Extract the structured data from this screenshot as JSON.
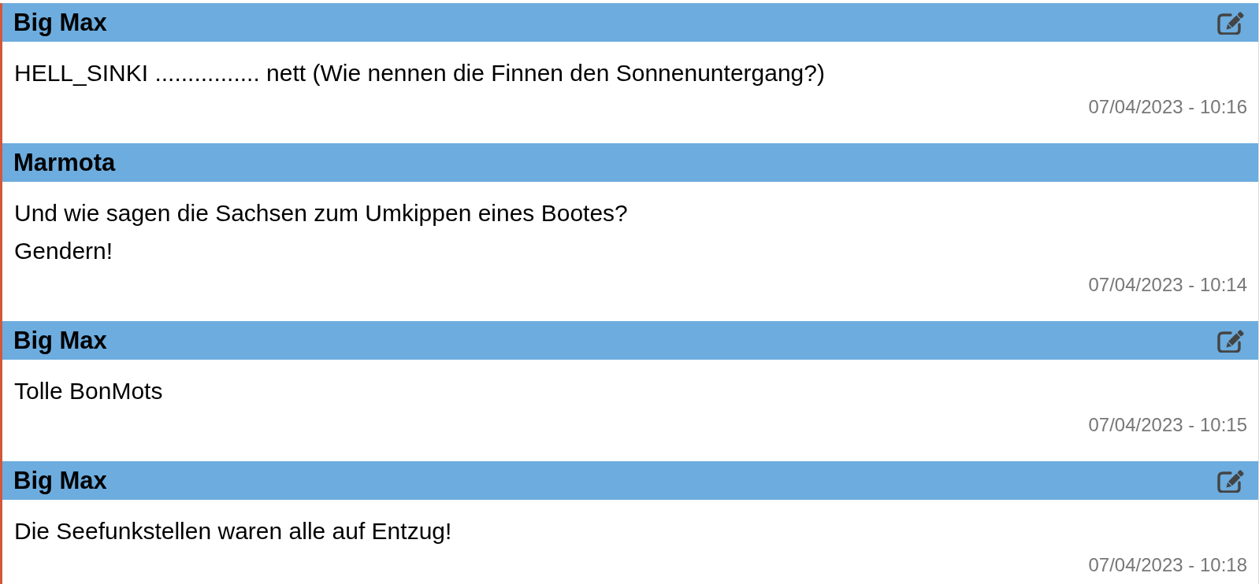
{
  "posts": [
    {
      "author": "Big Max",
      "editable": true,
      "paragraphs": [
        "HELL_SINKI ................ nett (Wie nennen die Finnen den Sonnenuntergang?)"
      ],
      "timestamp": "07/04/2023 - 10:16"
    },
    {
      "author": "Marmota",
      "editable": false,
      "paragraphs": [
        "Und wie sagen die Sachsen zum Umkippen eines Bootes?",
        "Gendern!"
      ],
      "timestamp": "07/04/2023 - 10:14"
    },
    {
      "author": "Big Max",
      "editable": true,
      "paragraphs": [
        "Tolle BonMots"
      ],
      "timestamp": "07/04/2023 - 10:15"
    },
    {
      "author": "Big Max",
      "editable": true,
      "paragraphs": [
        "Die Seefunkstellen waren alle auf Entzug!"
      ],
      "timestamp": "07/04/2023 - 10:18"
    }
  ]
}
